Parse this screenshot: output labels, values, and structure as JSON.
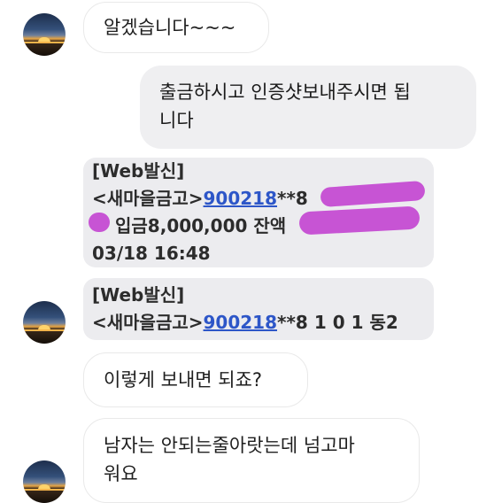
{
  "messages": [
    {
      "type": "received",
      "text": "알겠습니다~~~"
    },
    {
      "type": "sent",
      "lines": [
        "출금하시고 인증샷보내주시면 됩",
        "니다"
      ]
    },
    {
      "type": "sms_screenshot",
      "header": "[Web발신]",
      "sender_prefix": "<새마을금고>",
      "account": "900218",
      "account_suffix": "**8",
      "deposit_text": "입금8,000,000 잔액",
      "datetime": "03/18 16:48"
    },
    {
      "type": "sms_screenshot",
      "header": "[Web발신]",
      "sender_prefix": "<새마을금고>",
      "account": "900218",
      "account_suffix": "**8  1 0 1 동2"
    },
    {
      "type": "received",
      "text": "이렇게 보내면 되죠?"
    },
    {
      "type": "received",
      "lines": [
        "남자는 안되는줄아랏는데 넘고마",
        "워요"
      ]
    }
  ],
  "colors": {
    "sent_bubble": "#efeff1",
    "link": "#2d56c8",
    "redaction": "#c23fd0"
  },
  "avatar_icon": "sunset-avatar-icon"
}
